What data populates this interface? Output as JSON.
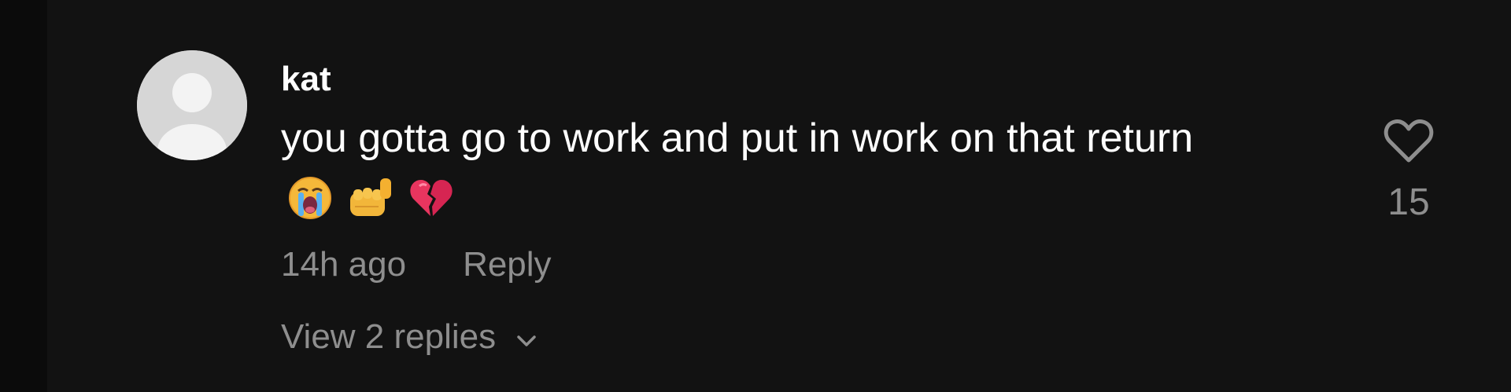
{
  "comment": {
    "username": "kat",
    "text": "you gotta go to work and put in work on that return",
    "emojis": [
      "loudly-crying-face",
      "oncoming-fist",
      "broken-heart"
    ],
    "timestamp": "14h ago",
    "reply_label": "Reply",
    "view_replies_label": "View 2 replies",
    "like_count": "15"
  },
  "icons": {
    "like": "heart-outline-icon",
    "expand": "chevron-down-icon"
  },
  "colors": {
    "background": "#121212",
    "primary_text": "#ffffff",
    "secondary_text": "#8e8e8e",
    "avatar_bg": "#d6d6d6"
  }
}
